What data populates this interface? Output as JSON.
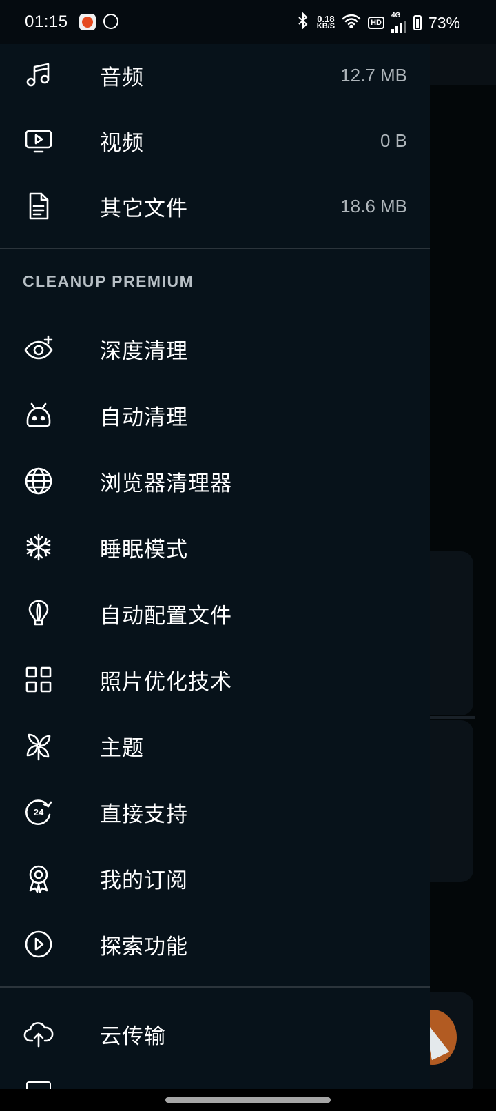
{
  "status_bar": {
    "time": "01:15",
    "speed_value": "0.18",
    "speed_unit": "KB/S",
    "hd_label": "HD",
    "network_label": "4G",
    "battery": "73%"
  },
  "drawer": {
    "storage_items": [
      {
        "label": "音频",
        "value": "12.7 MB",
        "icon": "music-note-icon"
      },
      {
        "label": "视频",
        "value": "0 B",
        "icon": "video-play-icon"
      },
      {
        "label": "其它文件",
        "value": "18.6 MB",
        "icon": "document-icon"
      }
    ],
    "premium_header": "CLEANUP PREMIUM",
    "premium_items": [
      {
        "label": "深度清理",
        "icon": "eye-plus-icon"
      },
      {
        "label": "自动清理",
        "icon": "robot-icon"
      },
      {
        "label": "浏览器清理器",
        "icon": "globe-icon"
      },
      {
        "label": "睡眠模式",
        "icon": "snowflake-icon"
      },
      {
        "label": "自动配置文件",
        "icon": "lightbulb-icon"
      },
      {
        "label": "照片优化技术",
        "icon": "grid-icon"
      },
      {
        "label": "主题",
        "icon": "pinwheel-icon"
      },
      {
        "label": "直接支持",
        "icon": "support-24-icon"
      },
      {
        "label": "我的订阅",
        "icon": "badge-icon"
      },
      {
        "label": "探索功能",
        "icon": "play-circle-icon"
      }
    ],
    "cloud_items": [
      {
        "label": "云传输",
        "icon": "cloud-upload-icon"
      }
    ]
  }
}
